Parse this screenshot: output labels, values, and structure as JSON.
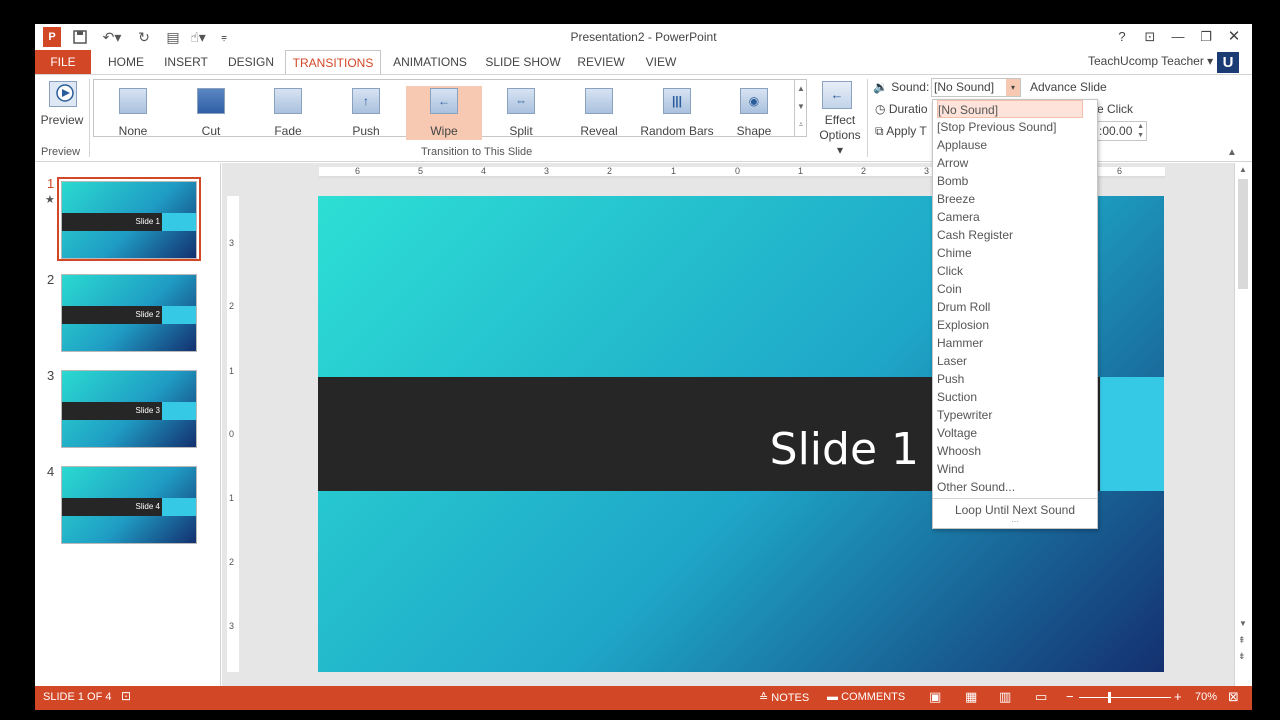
{
  "window": {
    "title": "Presentation2 - PowerPoint",
    "help": "?",
    "user": "TeachUcomp Teacher",
    "user_logo": "U"
  },
  "qat": {
    "app_icon": "P",
    "save_icon": "save-icon",
    "undo_icon": "undo-icon",
    "redo_icon": "redo-icon"
  },
  "tabs": [
    "FILE",
    "HOME",
    "INSERT",
    "DESIGN",
    "TRANSITIONS",
    "ANIMATIONS",
    "SLIDE SHOW",
    "REVIEW",
    "VIEW"
  ],
  "ribbon": {
    "preview_label": "Preview",
    "preview_group": "Preview",
    "transitions_group": "Transition to This Slide",
    "transitions": [
      {
        "label": "None",
        "glyph": ""
      },
      {
        "label": "Cut",
        "glyph": ""
      },
      {
        "label": "Fade",
        "glyph": ""
      },
      {
        "label": "Push",
        "glyph": "↑"
      },
      {
        "label": "Wipe",
        "glyph": "←"
      },
      {
        "label": "Split",
        "glyph": "⇔"
      },
      {
        "label": "Reveal",
        "glyph": ""
      },
      {
        "label": "Random Bars",
        "glyph": "|||"
      },
      {
        "label": "Shape",
        "glyph": "◉"
      }
    ],
    "effect_options": "Effect\nOptions",
    "effect_options_line1": "Effect",
    "effect_options_line2": "Options",
    "sound_label": "Sound:",
    "sound_value": "[No Sound]",
    "duration_label": "Duratio",
    "apply_label": "Apply T",
    "advance_slide": "Advance Slide",
    "on_click": "e Click",
    "after_value": ":00.00"
  },
  "sound_menu": {
    "items": [
      "[No Sound]",
      "[Stop Previous Sound]",
      "Applause",
      "Arrow",
      "Bomb",
      "Breeze",
      "Camera",
      "Cash Register",
      "Chime",
      "Click",
      "Coin",
      "Drum Roll",
      "Explosion",
      "Hammer",
      "Laser",
      "Push",
      "Suction",
      "Typewriter",
      "Voltage",
      "Whoosh",
      "Wind",
      "Other Sound..."
    ],
    "loop": "Loop Until Next Sound"
  },
  "slides": [
    {
      "num": "1",
      "title": "Slide 1"
    },
    {
      "num": "2",
      "title": "Slide 2"
    },
    {
      "num": "3",
      "title": "Slide 3"
    },
    {
      "num": "4",
      "title": "Slide 4"
    }
  ],
  "star": "★",
  "main_slide_title": "Slide 1",
  "ruler_h": [
    "6",
    "5",
    "4",
    "3",
    "2",
    "1",
    "0",
    "1",
    "2",
    "3",
    "6"
  ],
  "ruler_v": [
    "3",
    "2",
    "1",
    "0",
    "1",
    "2",
    "3"
  ],
  "status": {
    "slide_of": "SLIDE 1 OF 4",
    "notes": "NOTES",
    "comments": "COMMENTS",
    "zoom": "70%"
  },
  "colors": {
    "accent": "#d24726",
    "slide_dark": "#262626",
    "slide_teal": "#2ddfd5",
    "slide_navy": "#14306f"
  }
}
